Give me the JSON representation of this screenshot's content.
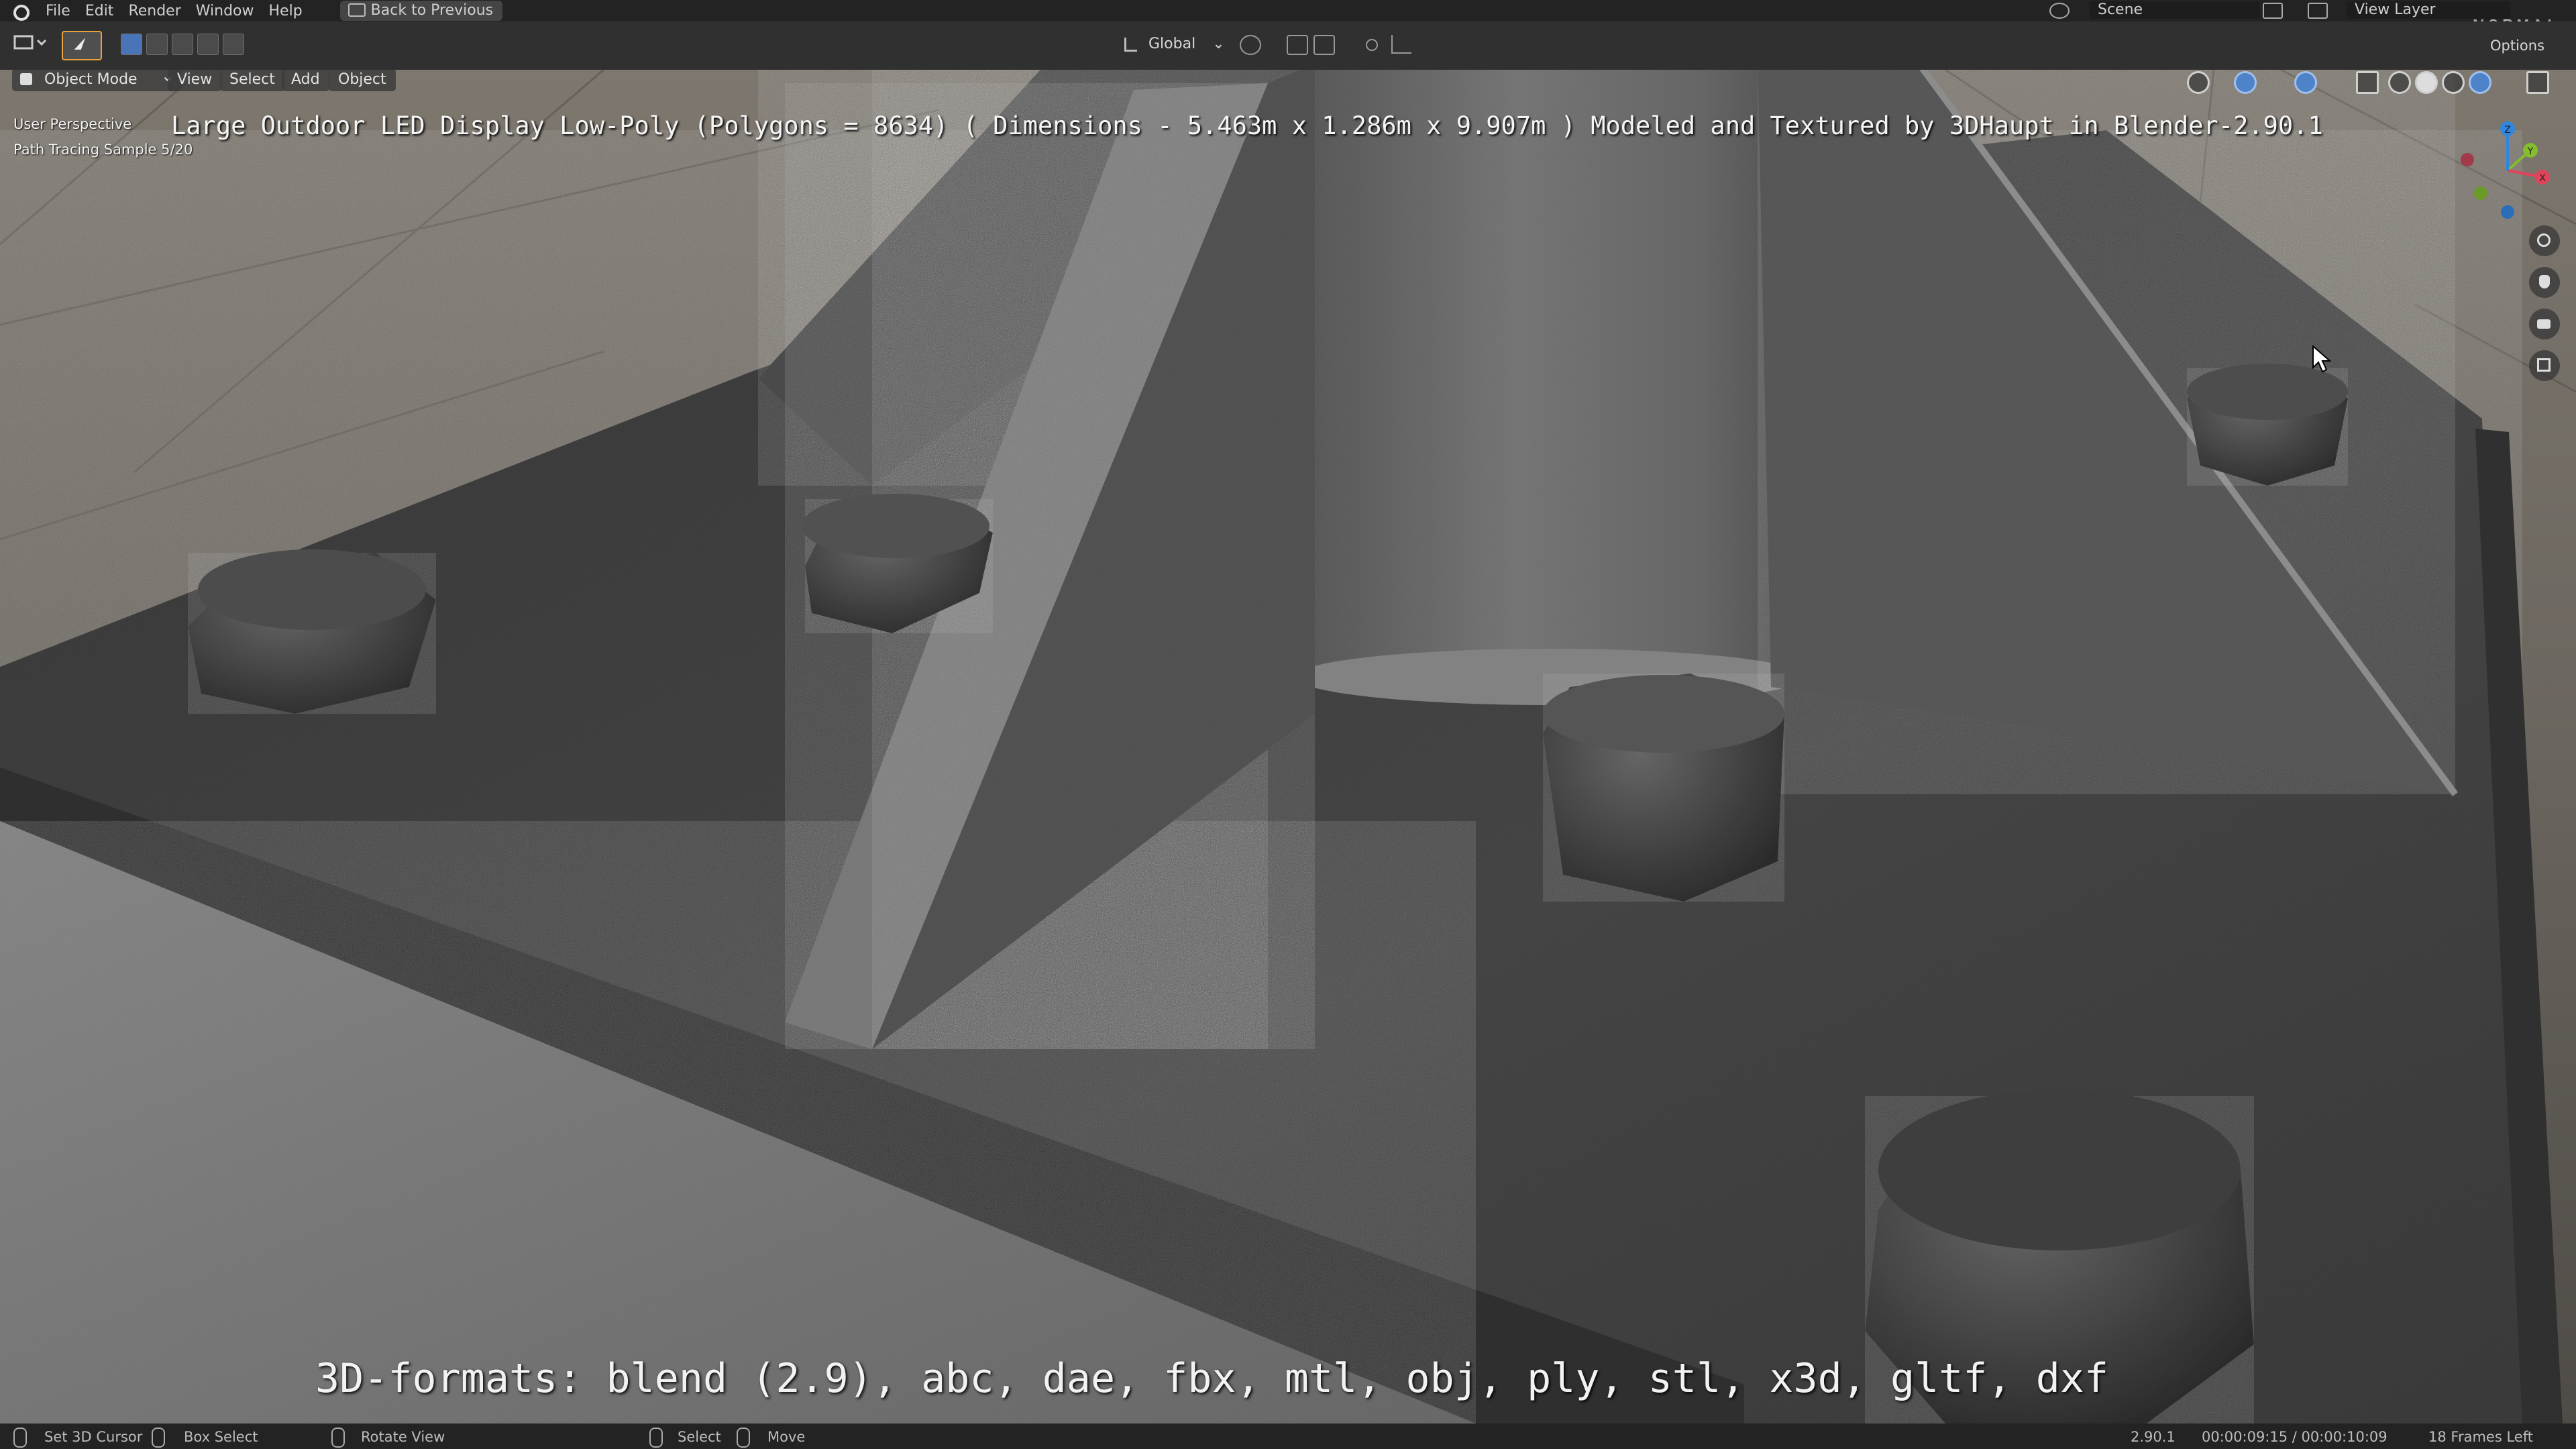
{
  "topbar": {
    "menus": [
      "File",
      "Edit",
      "Render",
      "Window",
      "Help"
    ],
    "back_button": "Back to Previous",
    "scene": "Scene",
    "view_layer": "View Layer",
    "watermark": "NORMAL"
  },
  "toolheader": {
    "transform_orientation": "Global",
    "options_label": "Options"
  },
  "viewport": {
    "mode": "Object Mode",
    "menus": [
      "View",
      "Select",
      "Add",
      "Object"
    ],
    "view_name": "User Perspective",
    "render_progress": "Path Tracing Sample 5/20",
    "title_caption": "Large Outdoor LED Display Low-Poly (Polygons = 8634) ( Dimensions -  5.463m x 1.286m x 9.907m ) Modeled and Textured by 3DHaupt in Blender-2.90.1",
    "formats_caption": "3D-formats: blend (2.9), abc, dae, fbx, mtl, obj, ply, stl, x3d, gltf, dxf",
    "gizmo_axes": [
      "X",
      "Y",
      "Z"
    ],
    "colors": {
      "x_axis": "#e0435a",
      "y_axis": "#84bd2d",
      "z_axis": "#2f86e0"
    }
  },
  "statusbar": {
    "left_hints": [
      "Set 3D Cursor",
      "Box Select",
      "Rotate View",
      "Select",
      "Move"
    ],
    "version": "2.90.1",
    "time": "00:00:09:15 / 00:00:10:09",
    "frames_left": "18 Frames Left"
  }
}
